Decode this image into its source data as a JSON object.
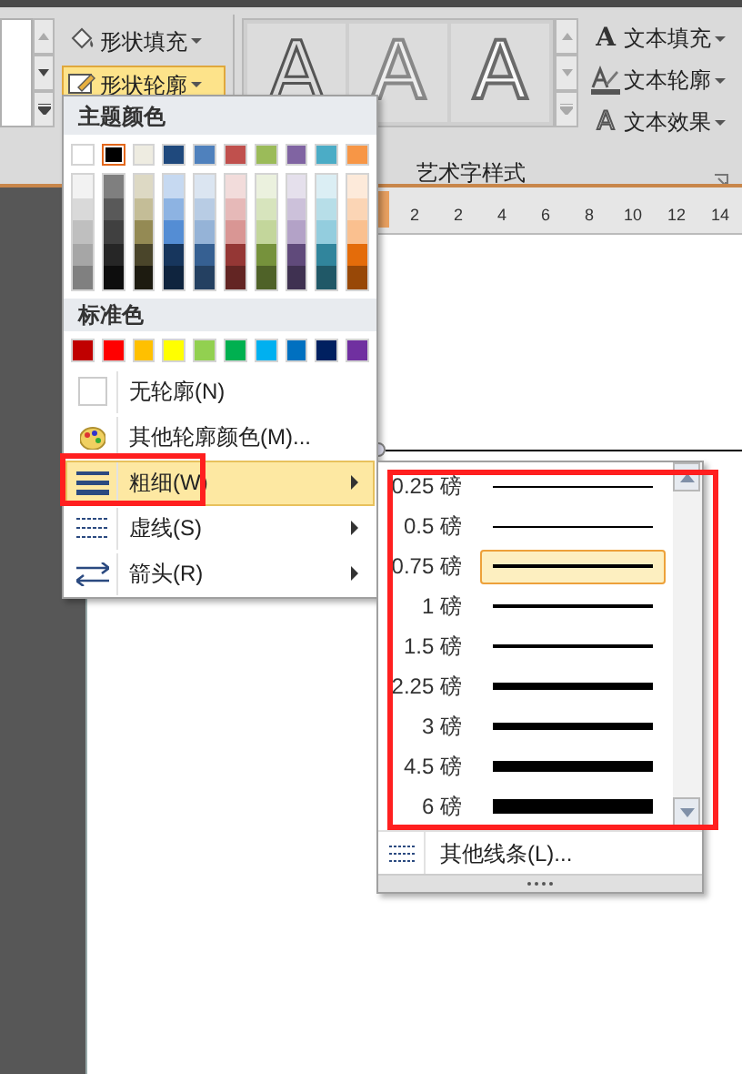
{
  "ribbon": {
    "shape_buttons": [
      {
        "label": "形状填充",
        "kind": "fill",
        "selected": false
      },
      {
        "label": "形状轮廓",
        "kind": "outline",
        "selected": true
      }
    ],
    "wordart_styles": [
      {
        "letter": "A",
        "kind": "outline"
      },
      {
        "letter": "A",
        "kind": "bevel"
      },
      {
        "letter": "A",
        "kind": "faded"
      }
    ],
    "text_buttons": [
      {
        "label": "文本填充",
        "kind": "fill",
        "icon": "A"
      },
      {
        "label": "文本轮廓",
        "kind": "outline"
      },
      {
        "label": "文本效果",
        "kind": "effect",
        "icon": "A"
      }
    ],
    "group_label": "艺术字样式"
  },
  "ruler": {
    "numbers": [
      "2",
      "2",
      "4",
      "6",
      "8",
      "10",
      "12",
      "14"
    ]
  },
  "outline_menu": {
    "theme_header": "主题颜色",
    "theme_colors": [
      {
        "color": "#ffffff",
        "selected": false,
        "shades": [
          {
            "color": "#f2f2f2"
          },
          {
            "color": "#d9d9d9"
          },
          {
            "color": "#bfbfbf"
          },
          {
            "color": "#a6a6a6"
          },
          {
            "color": "#808080"
          }
        ]
      },
      {
        "color": "#000000",
        "selected": true,
        "shades": [
          {
            "color": "#7f7f7f"
          },
          {
            "color": "#595959"
          },
          {
            "color": "#404040"
          },
          {
            "color": "#262626"
          },
          {
            "color": "#0d0d0d"
          }
        ]
      },
      {
        "color": "#eeece1",
        "selected": false,
        "shades": [
          {
            "color": "#ddd9c4"
          },
          {
            "color": "#c4bd97"
          },
          {
            "color": "#948a54"
          },
          {
            "color": "#4a452a"
          },
          {
            "color": "#1d1b10"
          }
        ]
      },
      {
        "color": "#1f497d",
        "selected": false,
        "shades": [
          {
            "color": "#c6d9f1"
          },
          {
            "color": "#8db3e2"
          },
          {
            "color": "#548dd4"
          },
          {
            "color": "#17365d"
          },
          {
            "color": "#0f243e"
          }
        ]
      },
      {
        "color": "#4f81bd",
        "selected": false,
        "shades": [
          {
            "color": "#dbe5f1"
          },
          {
            "color": "#b8cce4"
          },
          {
            "color": "#95b3d7"
          },
          {
            "color": "#366092"
          },
          {
            "color": "#244061"
          }
        ]
      },
      {
        "color": "#c0504d",
        "selected": false,
        "shades": [
          {
            "color": "#f2dcdb"
          },
          {
            "color": "#e6b9b8"
          },
          {
            "color": "#d99694"
          },
          {
            "color": "#953735"
          },
          {
            "color": "#632523"
          }
        ]
      },
      {
        "color": "#9bbb59",
        "selected": false,
        "shades": [
          {
            "color": "#ebf1de"
          },
          {
            "color": "#d7e4bd"
          },
          {
            "color": "#c3d69b"
          },
          {
            "color": "#76923c"
          },
          {
            "color": "#4f6228"
          }
        ]
      },
      {
        "color": "#8064a2",
        "selected": false,
        "shades": [
          {
            "color": "#e5e0ec"
          },
          {
            "color": "#ccc1da"
          },
          {
            "color": "#b3a2c7"
          },
          {
            "color": "#604a7b"
          },
          {
            "color": "#3f3151"
          }
        ]
      },
      {
        "color": "#4bacc6",
        "selected": false,
        "shades": [
          {
            "color": "#dbeef4"
          },
          {
            "color": "#b7dee8"
          },
          {
            "color": "#93cdde"
          },
          {
            "color": "#31859c"
          },
          {
            "color": "#205867"
          }
        ]
      },
      {
        "color": "#f79646",
        "selected": false,
        "shades": [
          {
            "color": "#fdeada"
          },
          {
            "color": "#fbd5b5"
          },
          {
            "color": "#fac08f"
          },
          {
            "color": "#e46c0a"
          },
          {
            "color": "#984807"
          }
        ]
      }
    ],
    "standard_header": "标准色",
    "standard_colors": [
      {
        "color": "#c00000"
      },
      {
        "color": "#ff0000"
      },
      {
        "color": "#ffc000"
      },
      {
        "color": "#ffff00"
      },
      {
        "color": "#92d050"
      },
      {
        "color": "#00b050"
      },
      {
        "color": "#00b0f0"
      },
      {
        "color": "#0070c0"
      },
      {
        "color": "#002060"
      },
      {
        "color": "#7030a0"
      }
    ],
    "items": [
      {
        "label": "无轮廓(N)",
        "kind": "none",
        "submenu": false,
        "selected": false
      },
      {
        "label": "其他轮廓颜色(M)...",
        "kind": "palette",
        "submenu": false,
        "selected": false
      },
      {
        "label": "粗细(W)",
        "kind": "weight",
        "submenu": true,
        "selected": true
      },
      {
        "label": "虚线(S)",
        "kind": "dash",
        "submenu": true,
        "selected": false
      },
      {
        "label": "箭头(R)",
        "kind": "arrow",
        "submenu": true,
        "selected": false
      }
    ]
  },
  "weight_menu": {
    "weights": [
      {
        "label": "0.25 磅",
        "selected": false
      },
      {
        "label": "0.5 磅",
        "selected": false
      },
      {
        "label": "0.75 磅",
        "selected": true
      },
      {
        "label": "1 磅",
        "selected": false
      },
      {
        "label": "1.5 磅",
        "selected": false
      },
      {
        "label": "2.25 磅",
        "selected": false
      },
      {
        "label": "3 磅",
        "selected": false
      },
      {
        "label": "4.5 磅",
        "selected": false
      },
      {
        "label": "6 磅",
        "selected": false
      }
    ],
    "more": "其他线条(L)..."
  }
}
